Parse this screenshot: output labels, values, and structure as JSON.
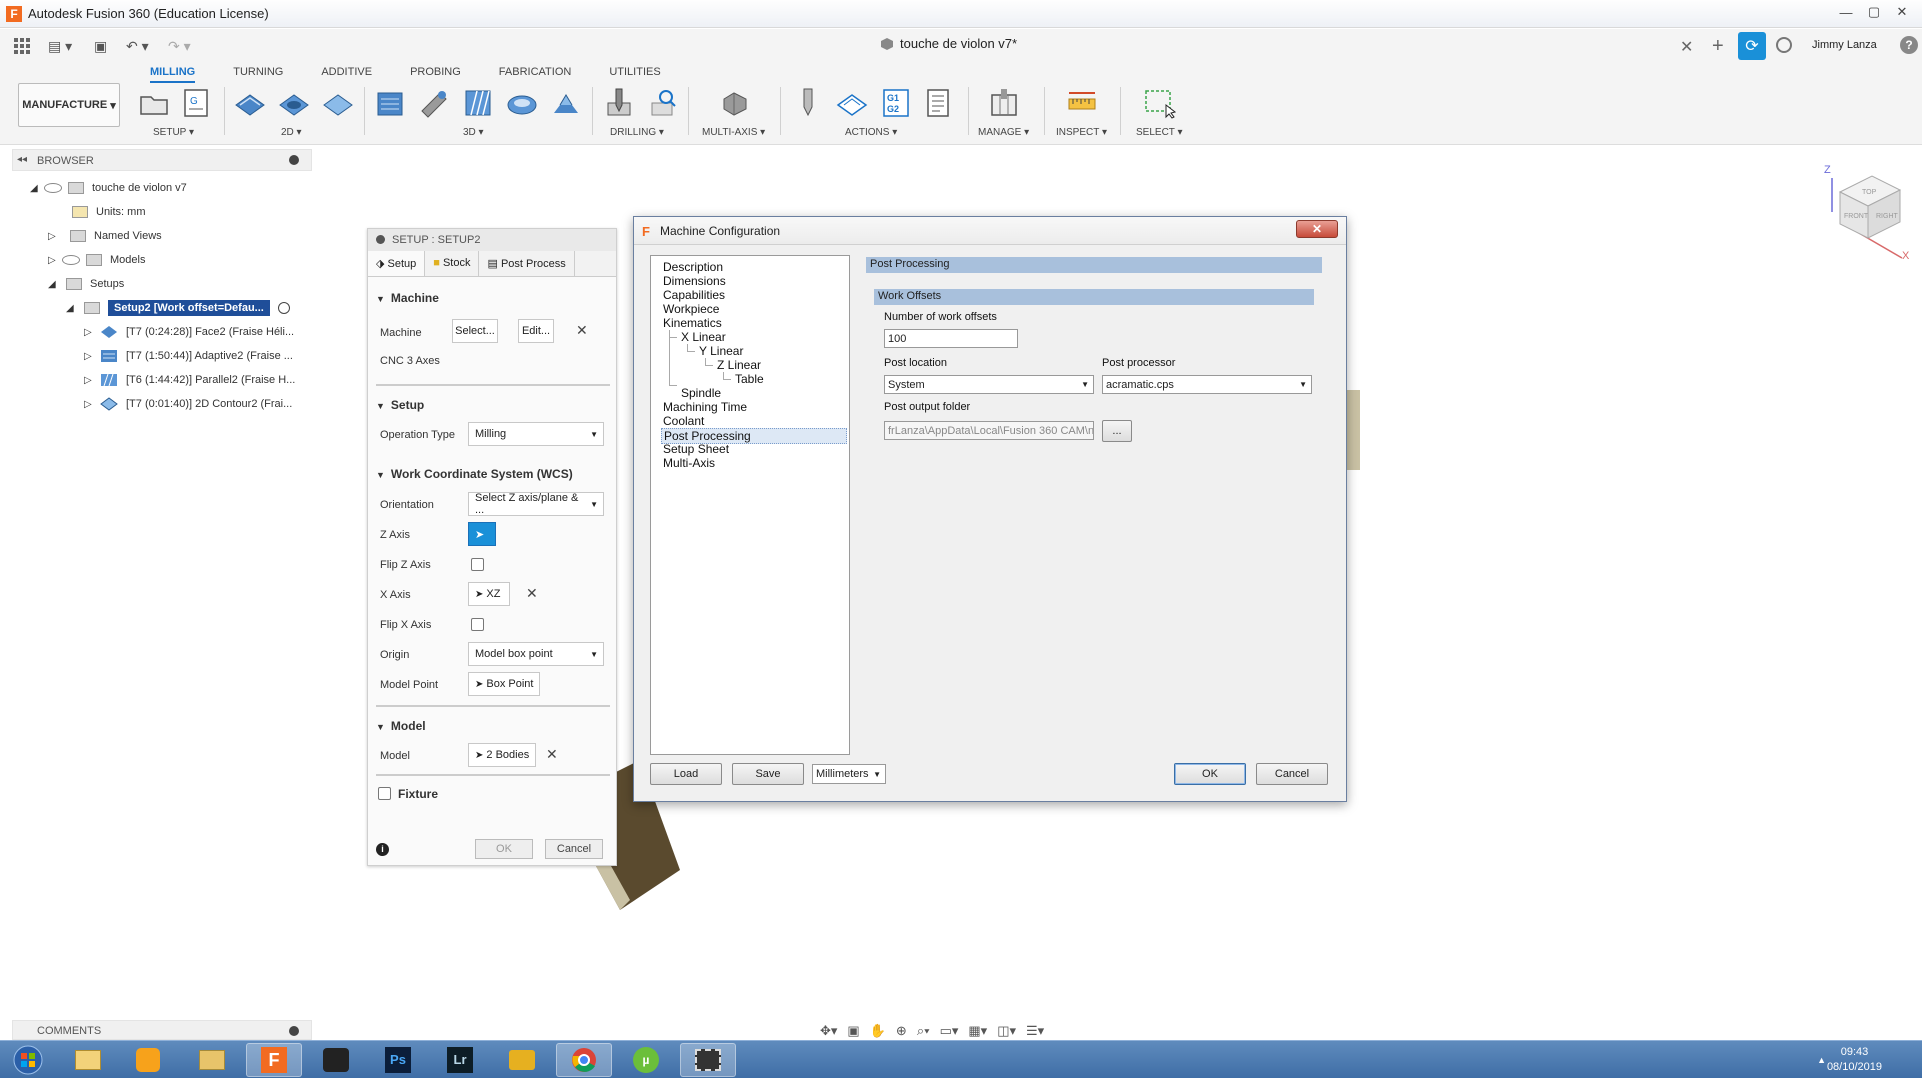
{
  "window": {
    "title": "Autodesk Fusion 360 (Education License)",
    "app_icon": "F"
  },
  "toolbar": {
    "doc_title": "touche de violon v7*",
    "user": "Jimmy Lanza"
  },
  "ribbon": {
    "tabs": [
      "MILLING",
      "TURNING",
      "ADDITIVE",
      "PROBING",
      "FABRICATION",
      "UTILITIES"
    ],
    "workspace": "MANUFACTURE",
    "groups": {
      "setup": "SETUP ▾",
      "two_d": "2D ▾",
      "three_d": "3D ▾",
      "drilling": "DRILLING ▾",
      "multi_axis": "MULTI-AXIS ▾",
      "actions": "ACTIONS ▾",
      "manage": "MANAGE ▾",
      "inspect": "INSPECT ▾",
      "select": "SELECT ▾"
    }
  },
  "browser": {
    "title": "BROWSER",
    "root": "touche de violon v7",
    "units": "Units: mm",
    "named_views": "Named Views",
    "models": "Models",
    "setups": "Setups",
    "setup2": "Setup2 [Work offset=Defau...",
    "ops": [
      "[T7 (0:24:28)] Face2 (Fraise Héli...",
      "[T7 (1:50:44)] Adaptive2 (Fraise ...",
      "[T6 (1:44:42)] Parallel2 (Fraise H...",
      "[T7 (0:01:40)] 2D Contour2 (Frai..."
    ]
  },
  "setup_panel": {
    "title": "SETUP : SETUP2",
    "tabs": [
      "Setup",
      "Stock",
      "Post Process"
    ],
    "machine_section": "Machine",
    "machine_label": "Machine",
    "select_btn": "Select...",
    "edit_btn": "Edit...",
    "machine_name": "CNC 3 Axes",
    "setup_section": "Setup",
    "op_type_label": "Operation Type",
    "op_type_value": "Milling",
    "wcs_section": "Work Coordinate System (WCS)",
    "orientation_label": "Orientation",
    "orientation_value": "Select Z axis/plane & ...",
    "z_axis_label": "Z Axis",
    "flip_z_label": "Flip Z Axis",
    "x_axis_label": "X Axis",
    "x_axis_value": "XZ",
    "flip_x_label": "Flip X Axis",
    "origin_label": "Origin",
    "origin_value": "Model box point",
    "model_point_label": "Model Point",
    "model_point_value": "Box Point",
    "model_section": "Model",
    "model_label": "Model",
    "model_value": "2 Bodies",
    "fixture_label": "Fixture",
    "ok": "OK",
    "cancel": "Cancel"
  },
  "machine_config": {
    "title": "Machine Configuration",
    "tree": [
      "Description",
      "Dimensions",
      "Capabilities",
      "Workpiece",
      "Kinematics",
      "X Linear",
      "Y Linear",
      "Z Linear",
      "Table",
      "Spindle",
      "Machining Time",
      "Coolant",
      "Post Processing",
      "Setup Sheet",
      "Multi-Axis"
    ],
    "section": "Post Processing",
    "subsection": "Work Offsets",
    "num_offsets_label": "Number of work offsets",
    "num_offsets_value": "100",
    "post_location_label": "Post location",
    "post_location_value": "System",
    "post_processor_label": "Post processor",
    "post_processor_value": "acramatic.cps",
    "output_folder_label": "Post output folder",
    "output_folder_value": "frLanza\\AppData\\Local\\Fusion 360 CAM\\nc",
    "browse": "...",
    "load": "Load",
    "save": "Save",
    "units_value": "Millimeters",
    "ok": "OK",
    "cancel": "Cancel"
  },
  "viewcube": {
    "z": "Z",
    "x": "X",
    "top": "TOP",
    "front": "FRONT",
    "right": "RIGHT"
  },
  "comments": {
    "title": "COMMENTS"
  },
  "taskbar": {
    "time": "09:43",
    "date": "08/10/2019"
  }
}
